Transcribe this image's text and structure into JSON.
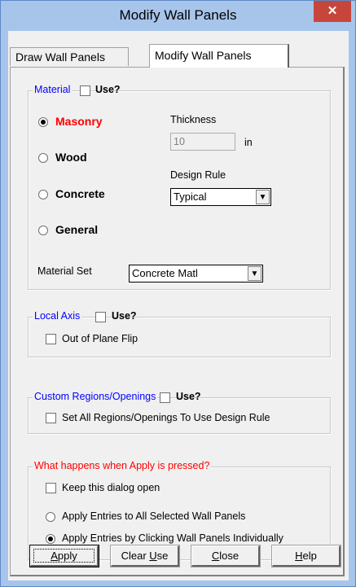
{
  "window": {
    "title": "Modify Wall Panels",
    "close_glyph": "✕"
  },
  "tabs": [
    {
      "label": "Draw Wall Panels",
      "active": false
    },
    {
      "label": "Modify Wall Panels",
      "active": true
    }
  ],
  "material": {
    "legend": "Material",
    "use_label": "Use?",
    "use_checked": false,
    "options": [
      {
        "label": "Masonry",
        "selected": true
      },
      {
        "label": "Wood",
        "selected": false
      },
      {
        "label": "Concrete",
        "selected": false
      },
      {
        "label": "General",
        "selected": false
      }
    ],
    "thickness_label": "Thickness",
    "thickness_value": "10",
    "thickness_unit": "in",
    "design_rule_label": "Design Rule",
    "design_rule_value": "Typical",
    "material_set_label": "Material Set",
    "material_set_value": "Concrete Matl"
  },
  "local_axis": {
    "legend": "Local Axis",
    "use_label": "Use?",
    "use_checked": false,
    "flip_label": "Out of Plane Flip",
    "flip_checked": false
  },
  "custom_regions": {
    "legend": "Custom Regions/Openings",
    "use_label": "Use?",
    "use_checked": false,
    "set_all_label": "Set All Regions/Openings To Use Design Rule",
    "set_all_checked": false
  },
  "apply_group": {
    "legend": "What happens when Apply is pressed?",
    "keep_open_label": "Keep this dialog open",
    "keep_open_checked": false,
    "options": [
      {
        "label": "Apply Entries to All Selected Wall Panels",
        "selected": false
      },
      {
        "label": "Apply Entries by Clicking Wall Panels Individually",
        "selected": true
      }
    ]
  },
  "buttons": {
    "apply": {
      "pre": "",
      "key": "A",
      "post": "pply"
    },
    "clear_use": {
      "pre": "Clear ",
      "key": "U",
      "post": "se"
    },
    "close": {
      "pre": "",
      "key": "C",
      "post": "lose"
    },
    "help": {
      "pre": "",
      "key": "H",
      "post": "elp"
    }
  },
  "colors": {
    "title_bar": "#a7c5ea",
    "close_button": "#c7463c",
    "legend_blue": "#0000ff",
    "legend_red": "#ff0000",
    "masonry_label": "#ff0000"
  }
}
